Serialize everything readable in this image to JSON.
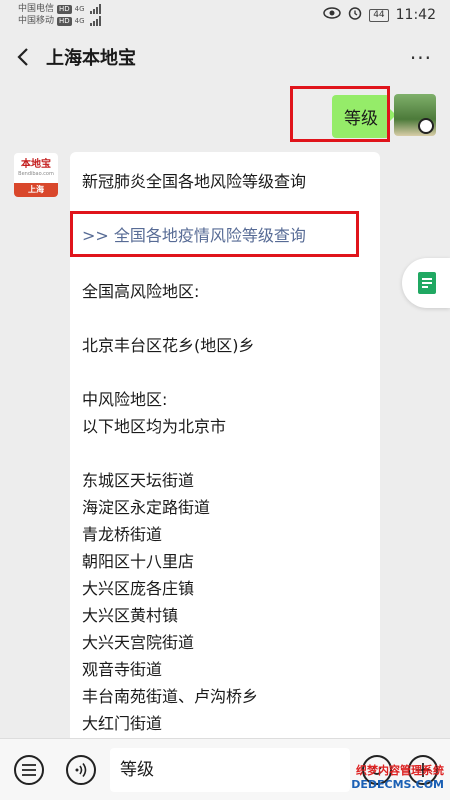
{
  "status_bar": {
    "carrier_1": "中国电信",
    "carrier_2": "中国移动",
    "hd_badge": "HD",
    "network": "4G",
    "battery": "44",
    "time": "11:42"
  },
  "header": {
    "title": "上海本地宝"
  },
  "outgoing": {
    "text": "等级"
  },
  "bot_avatar": {
    "logo": "本地宝",
    "domain": "Bendibao.com",
    "city": "上海"
  },
  "message": {
    "title": "新冠肺炎全国各地风险等级查询",
    "link_prefix": ">>",
    "link_text": "全国各地疫情风险等级查询",
    "lines": [
      "全国高风险地区:",
      "",
      "北京丰台区花乡(地区)乡",
      "",
      "中风险地区:",
      "以下地区均为北京市",
      "",
      "东城区天坛街道",
      "海淀区永定路街道",
      "青龙桥街道",
      "朝阳区十八里店",
      "大兴区庞各庄镇",
      "大兴区黄村镇",
      "大兴天宫院街道",
      "观音寺街道",
      "丰台南苑街道、卢沟桥乡",
      "大红门街道"
    ]
  },
  "input_bar": {
    "value": "等级"
  },
  "watermark": {
    "line1": "织梦内容管理系统",
    "line2": "DEDECMS.COM"
  },
  "colors": {
    "accent_green": "#95ec69",
    "link": "#576b95",
    "highlight": "#e0141b"
  }
}
